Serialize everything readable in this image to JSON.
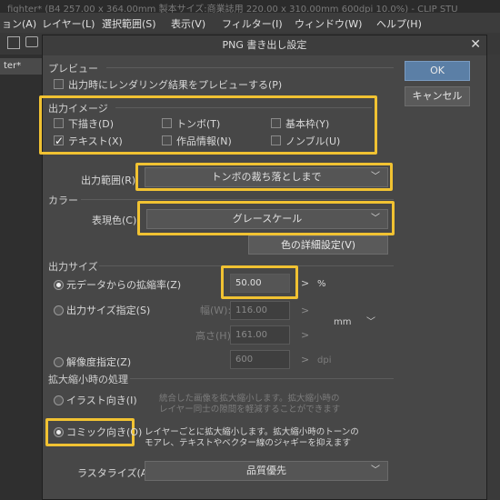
{
  "app": {
    "title": "fighter* (B4 257.00 x 364.00mm 製本サイズ:商業誌用 220.00 x 310.00mm 600dpi 10.0%) - CLIP STU",
    "menu": [
      "ョン(A)",
      "レイヤー(L)",
      "選択範囲(S)",
      "表示(V)",
      "フィルター(I)",
      "ウィンドウ(W)",
      "ヘルプ(H)"
    ],
    "tab_label": "ter*"
  },
  "dialog": {
    "title": "PNG 書き出し設定",
    "ok_label": "OK",
    "cancel_label": "キャンセル",
    "preview": {
      "heading": "プレビュー",
      "checkbox_label": "出力時にレンダリング結果をプレビューする(P)",
      "checked": false
    },
    "output_image": {
      "heading": "出力イメージ",
      "items": [
        {
          "label": "下描き(D)",
          "checked": false,
          "enabled": true
        },
        {
          "label": "トンボ(T)",
          "checked": false,
          "enabled": false
        },
        {
          "label": "基本枠(Y)",
          "checked": false,
          "enabled": true
        },
        {
          "label": "テキスト(X)",
          "checked": true,
          "enabled": true
        },
        {
          "label": "作品情報(N)",
          "checked": false,
          "enabled": true
        },
        {
          "label": "ノンブル(U)",
          "checked": false,
          "enabled": true
        }
      ]
    },
    "output_range": {
      "label": "出力範囲(R)",
      "value": "トンボの裁ち落としまで"
    },
    "color": {
      "heading": "カラー",
      "label": "表現色(C)",
      "value": "グレースケール",
      "detail_button": "色の詳細設定(V)"
    },
    "output_size": {
      "heading": "出力サイズ",
      "scale_label": "元データからの拡縮率(Z)",
      "scale_value": "50.00",
      "scale_unit": "%",
      "size_label": "出力サイズ指定(S)",
      "width_label": "幅(W):",
      "width_value": "116.00",
      "height_label": "高さ(H):",
      "height_value": "161.00",
      "unit": "mm",
      "resolution_label": "解像度指定(Z)",
      "resolution_value": "600",
      "resolution_unit": "dpi",
      "selected": "scale"
    },
    "scaling": {
      "heading": "拡大縮小時の処理",
      "illustration_label": "イラスト向き(I)",
      "illustration_desc": "統合した画像を拡大縮小します。拡大縮小時の\nレイヤー同士の隙間を軽減することができます",
      "comic_label": "コミック向き(O)",
      "comic_desc": "レイヤーごとに拡大縮小します。拡大縮小時のトーンの\nモアレ、テキストやベクター線のジャギーを抑えます",
      "selected": "comic"
    },
    "rasterize": {
      "label": "ラスタライズ(A):",
      "value": "品質優先"
    }
  },
  "colors": {
    "highlight": "#f1c232",
    "dialog_bg": "#474747",
    "ok_button": "#5b7fa6"
  }
}
